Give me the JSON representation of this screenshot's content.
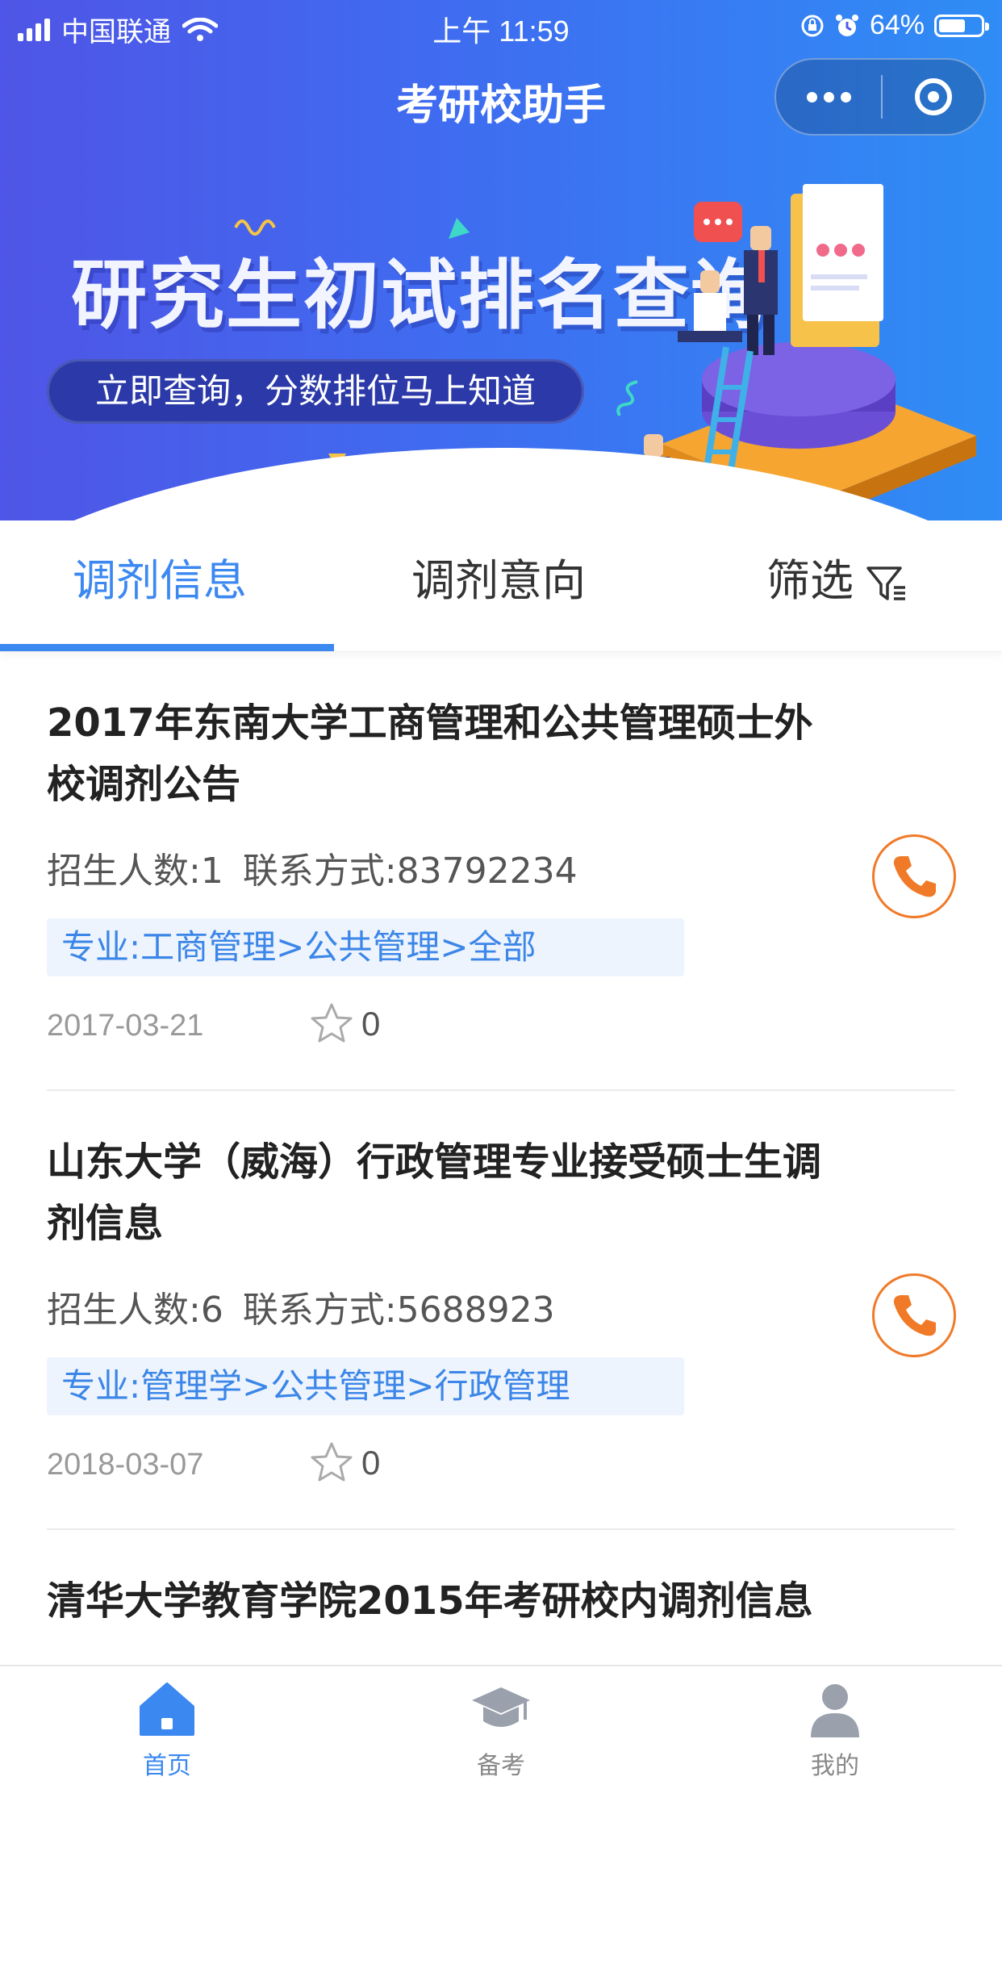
{
  "status_bar": {
    "carrier": "中国联通",
    "time": "上午 11:59",
    "battery_percent": "64%",
    "battery_level": 0.64
  },
  "nav": {
    "title": "考研校助手",
    "more_icon": "more-dots-icon",
    "close_icon": "target-circle-icon"
  },
  "banner": {
    "headline": "研究生初试排名查询",
    "pill_text": "立即查询，分数排位马上知道"
  },
  "tabs": [
    {
      "label": "调剂信息",
      "active": true
    },
    {
      "label": "调剂意向",
      "active": false
    },
    {
      "label": "筛选",
      "active": false,
      "icon": "filter-icon"
    }
  ],
  "list": [
    {
      "title": "2017年东南大学工商管理和公共管理硕士外校调剂公告",
      "enroll": "招生人数:1",
      "contact": "联系方式:83792234",
      "tag": "专业:工商管理>公共管理>全部",
      "date": "2017-03-21",
      "stars": "0"
    },
    {
      "title": "山东大学（威海）行政管理专业接受硕士生调剂信息",
      "enroll": "招生人数:6",
      "contact": "联系方式:5688923",
      "tag": "专业:管理学>公共管理>行政管理",
      "date": "2018-03-07",
      "stars": "0"
    },
    {
      "title": "清华大学教育学院2015年考研校内调剂信息"
    }
  ],
  "bottom_nav": [
    {
      "label": "首页",
      "icon": "home-icon",
      "active": true
    },
    {
      "label": "备考",
      "icon": "graduation-cap-icon",
      "active": false
    },
    {
      "label": "我的",
      "icon": "user-icon",
      "active": false
    }
  ],
  "colors": {
    "accent": "#3b88f0",
    "phone": "#f07a28",
    "tag_bg": "#eef4fd"
  }
}
